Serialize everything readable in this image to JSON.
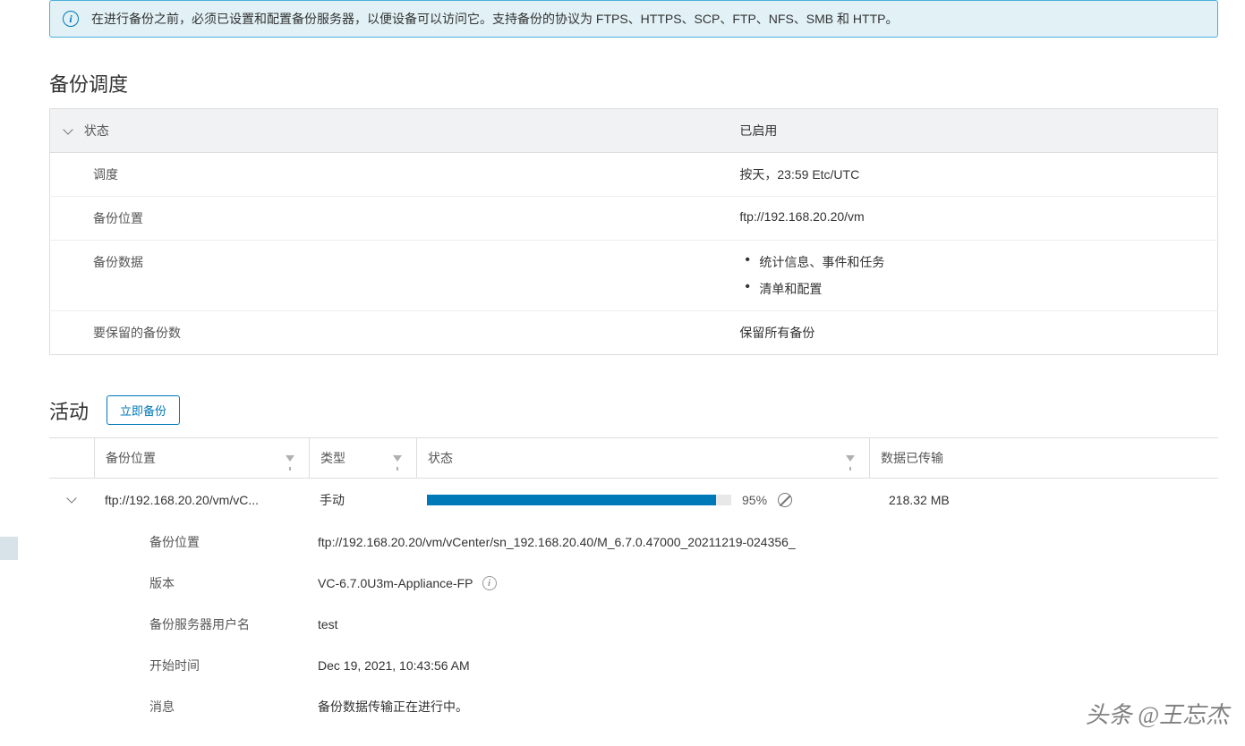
{
  "info_banner": {
    "text": "在进行备份之前，必须已设置和配置备份服务器，以便设备可以访问它。支持备份的协议为 FTPS、HTTPS、SCP、FTP、NFS、SMB 和 HTTP。"
  },
  "schedule": {
    "title": "备份调度",
    "header_label": "状态",
    "header_value": "已启用",
    "rows": [
      {
        "label": "调度",
        "value": "按天，23:59 Etc/UTC"
      },
      {
        "label": "备份位置",
        "value": "ftp://192.168.20.20/vm"
      },
      {
        "label": "备份数据",
        "list": [
          "统计信息、事件和任务",
          "清单和配置"
        ]
      },
      {
        "label": "要保留的备份数",
        "value": "保留所有备份"
      }
    ]
  },
  "activity": {
    "title": "活动",
    "backup_now_label": "立即备份",
    "columns": {
      "location": "备份位置",
      "type": "类型",
      "status": "状态",
      "transferred": "数据已传输"
    },
    "row": {
      "location_short": "ftp://192.168.20.20/vm/vC...",
      "type": "手动",
      "progress_pct": 95,
      "progress_text": "95%",
      "transferred": "218.32 MB"
    },
    "details": {
      "location_label": "备份位置",
      "location_value": "ftp://192.168.20.20/vm/vCenter/sn_192.168.20.40/M_6.7.0.47000_20211219-024356_",
      "version_label": "版本",
      "version_value": "VC-6.7.0U3m-Appliance-FP",
      "username_label": "备份服务器用户名",
      "username_value": "test",
      "start_label": "开始时间",
      "start_value": "Dec 19, 2021, 10:43:56 AM",
      "message_label": "消息",
      "message_value": "备份数据传输正在进行中。"
    }
  },
  "watermark": "头条 @王忘杰"
}
